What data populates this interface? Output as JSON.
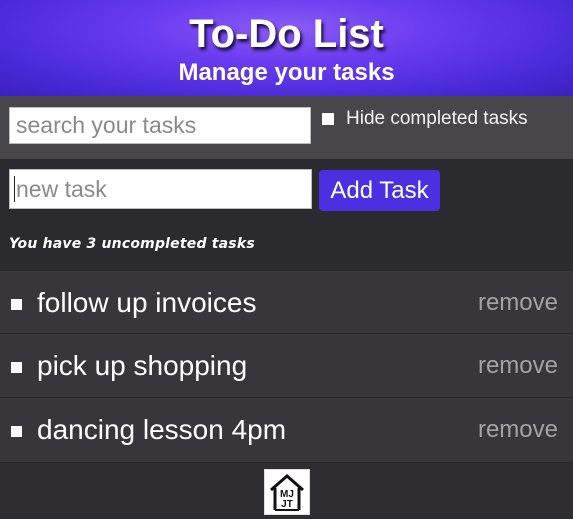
{
  "header": {
    "title": "To-Do List",
    "subtitle": "Manage your tasks"
  },
  "search": {
    "placeholder": "search your tasks",
    "hide_completed_label": "Hide completed tasks"
  },
  "new_task": {
    "placeholder": "new task",
    "add_button_label": "Add Task"
  },
  "status": {
    "uncompleted_text": "You have 3 uncompleted tasks"
  },
  "tasks": [
    {
      "text": "follow up invoices",
      "remove_label": "remove"
    },
    {
      "text": "pick up shopping",
      "remove_label": "remove"
    },
    {
      "text": "dancing lesson 4pm",
      "remove_label": "remove"
    }
  ],
  "footer": {
    "logo_text": "MJT",
    "logo_icon": "house-logo-icon"
  },
  "colors": {
    "header_accent": "#5a35e8",
    "button": "#4b2fe0",
    "background": "#2b2a2e",
    "task_row": "#38363b",
    "remove_text": "#a3a3a3"
  }
}
